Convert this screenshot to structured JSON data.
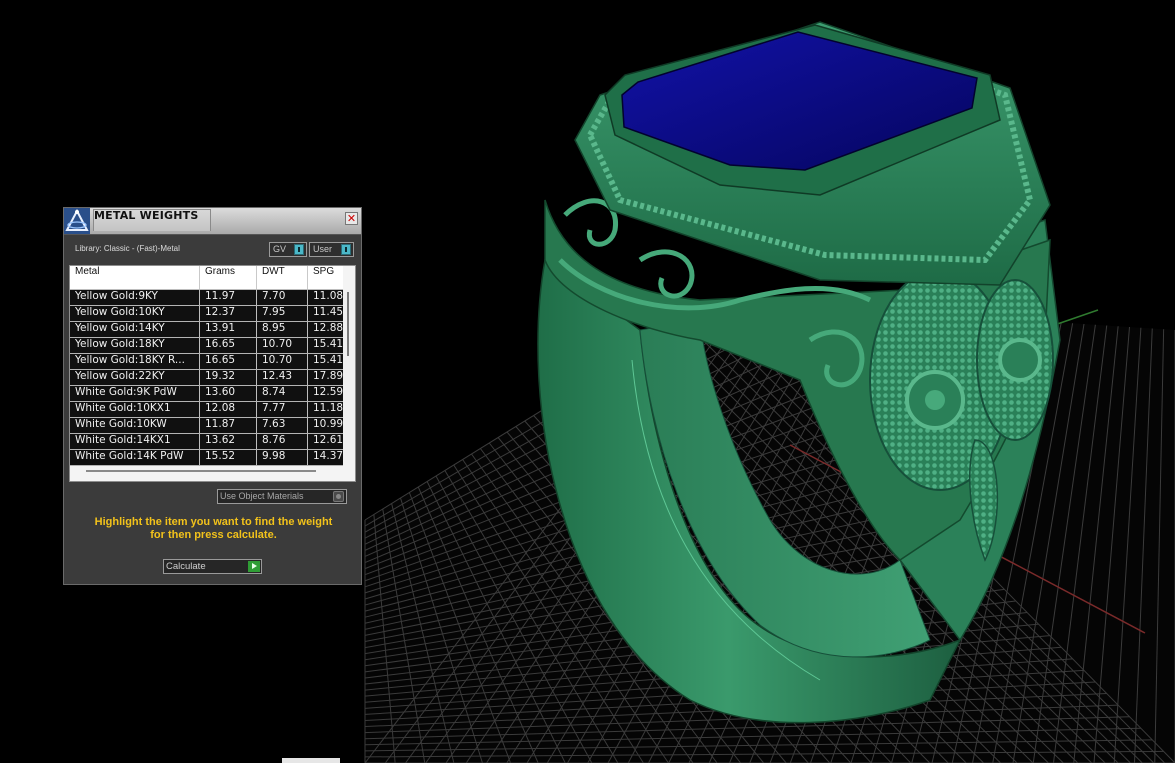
{
  "dialog": {
    "title": "METAL WEIGHTS",
    "close_glyph": "✕",
    "library_label": "Library: Classic - (Fast)-Metal",
    "toggle_gv": "GV",
    "toggle_user": "User",
    "columns": [
      "Metal",
      "Grams",
      "DWT",
      "SPG"
    ],
    "rows": [
      [
        "Yellow Gold:9KY",
        "11.97",
        "7.70",
        "11.08"
      ],
      [
        "Yellow Gold:10KY",
        "12.37",
        "7.95",
        "11.45"
      ],
      [
        "Yellow Gold:14KY",
        "13.91",
        "8.95",
        "12.88"
      ],
      [
        "Yellow Gold:18KY",
        "16.65",
        "10.70",
        "15.41"
      ],
      [
        "Yellow Gold:18KY R...",
        "16.65",
        "10.70",
        "15.41"
      ],
      [
        "Yellow Gold:22KY",
        "19.32",
        "12.43",
        "17.89"
      ],
      [
        "White Gold:9K PdW",
        "13.60",
        "8.74",
        "12.59"
      ],
      [
        "White Gold:10KX1",
        "12.08",
        "7.77",
        "11.18"
      ],
      [
        "White Gold:10KW",
        "11.87",
        "7.63",
        "10.99"
      ],
      [
        "White Gold:14KX1",
        "13.62",
        "8.76",
        "12.61"
      ],
      [
        "White Gold:14K PdW",
        "15.52",
        "9.98",
        "14.37"
      ]
    ],
    "use_object_materials": "Use Object Materials",
    "hint_line1": "Highlight the item you want to find the weight",
    "hint_line2": "for then press calculate.",
    "calculate_label": "Calculate"
  },
  "icons": {
    "logo": "matrix-logo-icon",
    "close": "close-icon",
    "play": "play-arrow-icon"
  },
  "colors": {
    "ring_metal": "#2e8a5e",
    "gem": "#0a0a8c",
    "hint_text": "#f2c21b",
    "grid": "#3a3a3a"
  }
}
